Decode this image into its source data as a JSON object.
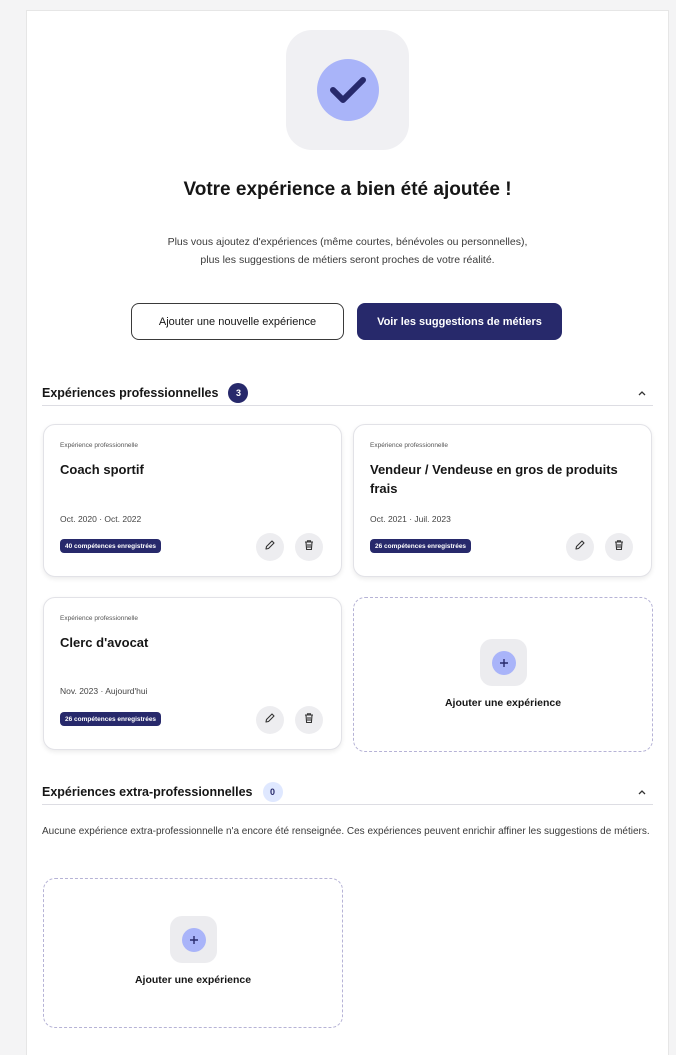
{
  "header": {
    "title": "Votre expérience a bien été ajoutée !",
    "intro_line1": "Plus vous ajoutez d'expériences (même courtes, bénévoles ou personnelles),",
    "intro_line2": "plus les suggestions de métiers seront proches de votre réalité.",
    "success_icon": "check-icon"
  },
  "actions": {
    "add_new_label": "Ajouter une nouvelle expérience",
    "see_suggestions_label": "Voir les suggestions de métiers"
  },
  "professional": {
    "title": "Expériences professionnelles",
    "count": "3",
    "cards": [
      {
        "kicker": "Expérience professionnelle",
        "title": "Coach sportif",
        "dates": "Oct. 2020 · Oct. 2022",
        "skills": "40 compétences enregistrées"
      },
      {
        "kicker": "Expérience professionnelle",
        "title": "Vendeur / Vendeuse en gros de produits frais",
        "dates": "Oct. 2021 · Juil. 2023",
        "skills": "26 compétences enregistrées"
      },
      {
        "kicker": "Expérience professionnelle",
        "title": "Clerc d'avocat",
        "dates": "Nov. 2023 · Aujourd'hui",
        "skills": "26 compétences enregistrées"
      }
    ],
    "add_label": "Ajouter une expérience"
  },
  "extra": {
    "title": "Expériences extra-professionnelles",
    "count": "0",
    "empty_text": "Aucune expérience extra-professionnelle n'a encore été renseignée. Ces expériences peuvent enrichir affiner les suggestions de métiers.",
    "add_label": "Ajouter une expérience"
  },
  "colors": {
    "primary": "#27296b",
    "accent_light": "#a9b4f9",
    "badge_light": "#dfe8ff"
  }
}
